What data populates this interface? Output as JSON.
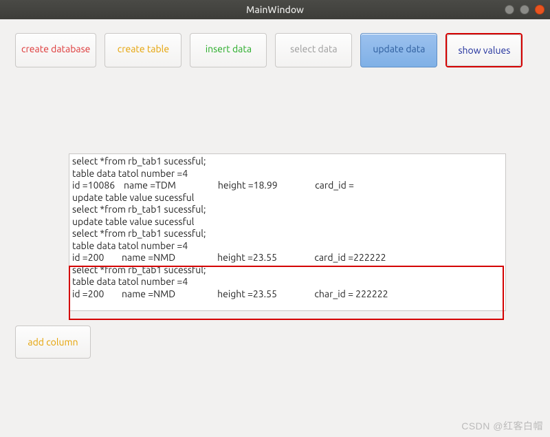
{
  "window": {
    "title": "MainWindow"
  },
  "buttons": {
    "create_database": "create database",
    "create_table": "create table",
    "insert_data": "insert data",
    "select_data": "select data",
    "update_data": "update data",
    "show_values": "show values",
    "add_column": "add column"
  },
  "output_lines": [
    "select *from rb_tab1 sucessful;",
    "table data tatol number =4",
    "id =10086    name =TDM                   height =18.99                 card_id =",
    "update table value sucessful",
    "select *from rb_tab1 sucessful;",
    "update table value sucessful",
    "select *from rb_tab1 sucessful;",
    "table data tatol number =4",
    "id =200        name =NMD                   height =23.55                 card_id =222222",
    "select *from rb_tab1 sucessful;",
    "table data tatol number =4",
    "id =200        name =NMD                   height =23.55                 char_id = 222222"
  ],
  "watermark": "CSDN @红客白帽"
}
